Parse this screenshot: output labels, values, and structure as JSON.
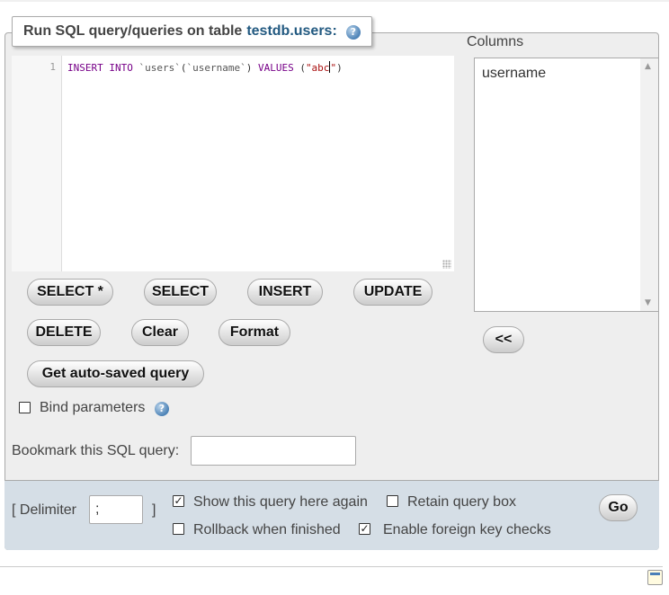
{
  "legend": {
    "prefix": "Run SQL query/queries on table",
    "table_link": "testdb.users:",
    "help_icon": "help-icon"
  },
  "editor": {
    "line_number": "1",
    "code_parts": [
      {
        "text": "INSERT INTO ",
        "class": "kw"
      },
      {
        "text": "`users`",
        "class": "bq"
      },
      {
        "text": "(",
        "class": ""
      },
      {
        "text": "`username`",
        "class": "bq"
      },
      {
        "text": ") ",
        "class": ""
      },
      {
        "text": "VALUES ",
        "class": "kw"
      },
      {
        "text": "(",
        "class": ""
      },
      {
        "text": "\"abc",
        "class": "str"
      },
      {
        "text": "|CURSOR|",
        "class": "cursor"
      },
      {
        "text": "\"",
        "class": "str"
      },
      {
        "text": ")",
        "class": ""
      }
    ]
  },
  "buttons": {
    "select_star": "SELECT *",
    "select": "SELECT",
    "insert": "INSERT",
    "update": "UPDATE",
    "delete": "DELETE",
    "clear": "Clear",
    "format": "Format",
    "autosaved": "Get auto-saved query",
    "insert_column": "<<",
    "go": "Go"
  },
  "columns": {
    "label": "Columns",
    "items": [
      "username"
    ]
  },
  "bind_parameters": {
    "label": "Bind parameters",
    "checked": false
  },
  "bookmark": {
    "label": "Bookmark this SQL query:",
    "value": ""
  },
  "options": {
    "delimiter_open": "[ Delimiter",
    "delimiter_value": ";",
    "delimiter_close": "]",
    "show_query": {
      "label": "Show this query here again",
      "checked": true
    },
    "retain_box": {
      "label": "Retain query box",
      "checked": false
    },
    "rollback": {
      "label": "Rollback when finished",
      "checked": false
    },
    "foreign_keys": {
      "label": "Enable foreign key checks",
      "checked": true
    }
  }
}
